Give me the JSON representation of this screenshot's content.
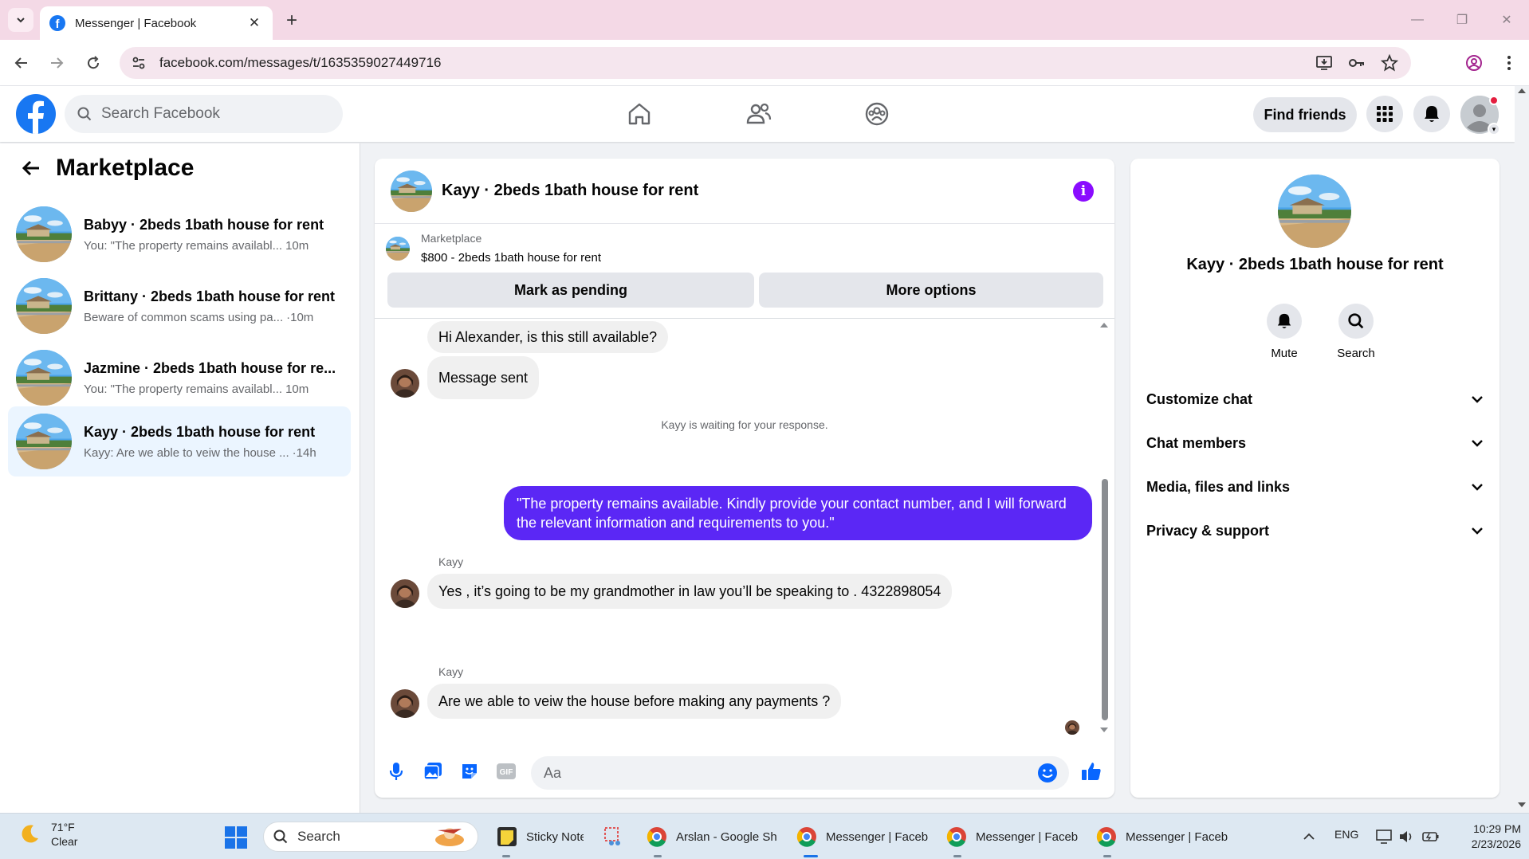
{
  "browser": {
    "tab_title": "Messenger | Facebook",
    "url": "facebook.com/messages/t/1635359027449716"
  },
  "header": {
    "search_placeholder": "Search Facebook",
    "find_friends": "Find friends"
  },
  "sidebar": {
    "title": "Marketplace",
    "conversations": [
      {
        "name": "Babyy · 2beds 1bath house for rent",
        "preview": "You: \"The property remains availabl...",
        "time": "10m"
      },
      {
        "name": "Brittany · 2beds 1bath house for rent",
        "preview": "Beware of common scams using pa...",
        "time": "·10m"
      },
      {
        "name": "Jazmine · 2beds 1bath house for re...",
        "preview": "You: \"The property remains availabl...",
        "time": "10m"
      },
      {
        "name": "Kayy · 2beds 1bath house for rent",
        "preview": "Kayy: Are we able to veiw the house ...",
        "time": "·14h"
      }
    ]
  },
  "chat": {
    "title": "Kayy · 2beds 1bath house for rent",
    "listing_source": "Marketplace",
    "listing_title": "$800 - 2beds 1bath house for rent",
    "mark_pending": "Mark as pending",
    "more_options": "More options",
    "messages": {
      "m1": "Hi Alexander, is this still available?",
      "m2": "Message sent",
      "waiting": "Kayy is waiting for your response.",
      "m3": "\"The property remains available. Kindly provide your contact number, and I will forward the relevant information and requirements to you.\"",
      "sender1": "Kayy",
      "m4": "Yes , it’s going to be my grandmother in law you’ll be speaking to . 4322898054",
      "sender2": "Kayy",
      "m5": "Are we able to veiw the house before making any payments ?"
    },
    "composer_placeholder": "Aa",
    "gif_label": "GIF"
  },
  "info_panel": {
    "name": "Kayy · 2beds 1bath house for rent",
    "mute": "Mute",
    "search": "Search",
    "sections": [
      "Customize chat",
      "Chat members",
      "Media, files and links",
      "Privacy & support"
    ]
  },
  "taskbar": {
    "temp": "71°F",
    "condition": "Clear",
    "search": "Search",
    "apps": [
      "Sticky Note",
      "Arslan - Google Sh",
      "Messenger | Faceb",
      "Messenger | Faceb",
      "Messenger | Faceb"
    ],
    "lang": "ENG",
    "time": "10:29 PM",
    "date": "2/23/2026"
  },
  "colors": {
    "fb_blue": "#1877f2",
    "outgoing_bubble": "#5b27f5",
    "info_purple": "#8a0cff",
    "active_row": "#ebf5ff"
  }
}
